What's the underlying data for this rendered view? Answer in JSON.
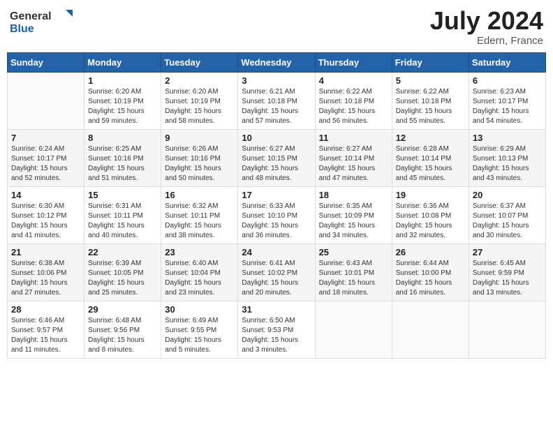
{
  "logo": {
    "line1": "General",
    "line2": "Blue"
  },
  "title": "July 2024",
  "location": "Edern, France",
  "days_header": [
    "Sunday",
    "Monday",
    "Tuesday",
    "Wednesday",
    "Thursday",
    "Friday",
    "Saturday"
  ],
  "weeks": [
    [
      {
        "num": "",
        "info": ""
      },
      {
        "num": "1",
        "info": "Sunrise: 6:20 AM\nSunset: 10:19 PM\nDaylight: 15 hours\nand 59 minutes."
      },
      {
        "num": "2",
        "info": "Sunrise: 6:20 AM\nSunset: 10:19 PM\nDaylight: 15 hours\nand 58 minutes."
      },
      {
        "num": "3",
        "info": "Sunrise: 6:21 AM\nSunset: 10:18 PM\nDaylight: 15 hours\nand 57 minutes."
      },
      {
        "num": "4",
        "info": "Sunrise: 6:22 AM\nSunset: 10:18 PM\nDaylight: 15 hours\nand 56 minutes."
      },
      {
        "num": "5",
        "info": "Sunrise: 6:22 AM\nSunset: 10:18 PM\nDaylight: 15 hours\nand 55 minutes."
      },
      {
        "num": "6",
        "info": "Sunrise: 6:23 AM\nSunset: 10:17 PM\nDaylight: 15 hours\nand 54 minutes."
      }
    ],
    [
      {
        "num": "7",
        "info": "Sunrise: 6:24 AM\nSunset: 10:17 PM\nDaylight: 15 hours\nand 52 minutes."
      },
      {
        "num": "8",
        "info": "Sunrise: 6:25 AM\nSunset: 10:16 PM\nDaylight: 15 hours\nand 51 minutes."
      },
      {
        "num": "9",
        "info": "Sunrise: 6:26 AM\nSunset: 10:16 PM\nDaylight: 15 hours\nand 50 minutes."
      },
      {
        "num": "10",
        "info": "Sunrise: 6:27 AM\nSunset: 10:15 PM\nDaylight: 15 hours\nand 48 minutes."
      },
      {
        "num": "11",
        "info": "Sunrise: 6:27 AM\nSunset: 10:14 PM\nDaylight: 15 hours\nand 47 minutes."
      },
      {
        "num": "12",
        "info": "Sunrise: 6:28 AM\nSunset: 10:14 PM\nDaylight: 15 hours\nand 45 minutes."
      },
      {
        "num": "13",
        "info": "Sunrise: 6:29 AM\nSunset: 10:13 PM\nDaylight: 15 hours\nand 43 minutes."
      }
    ],
    [
      {
        "num": "14",
        "info": "Sunrise: 6:30 AM\nSunset: 10:12 PM\nDaylight: 15 hours\nand 41 minutes."
      },
      {
        "num": "15",
        "info": "Sunrise: 6:31 AM\nSunset: 10:11 PM\nDaylight: 15 hours\nand 40 minutes."
      },
      {
        "num": "16",
        "info": "Sunrise: 6:32 AM\nSunset: 10:11 PM\nDaylight: 15 hours\nand 38 minutes."
      },
      {
        "num": "17",
        "info": "Sunrise: 6:33 AM\nSunset: 10:10 PM\nDaylight: 15 hours\nand 36 minutes."
      },
      {
        "num": "18",
        "info": "Sunrise: 6:35 AM\nSunset: 10:09 PM\nDaylight: 15 hours\nand 34 minutes."
      },
      {
        "num": "19",
        "info": "Sunrise: 6:36 AM\nSunset: 10:08 PM\nDaylight: 15 hours\nand 32 minutes."
      },
      {
        "num": "20",
        "info": "Sunrise: 6:37 AM\nSunset: 10:07 PM\nDaylight: 15 hours\nand 30 minutes."
      }
    ],
    [
      {
        "num": "21",
        "info": "Sunrise: 6:38 AM\nSunset: 10:06 PM\nDaylight: 15 hours\nand 27 minutes."
      },
      {
        "num": "22",
        "info": "Sunrise: 6:39 AM\nSunset: 10:05 PM\nDaylight: 15 hours\nand 25 minutes."
      },
      {
        "num": "23",
        "info": "Sunrise: 6:40 AM\nSunset: 10:04 PM\nDaylight: 15 hours\nand 23 minutes."
      },
      {
        "num": "24",
        "info": "Sunrise: 6:41 AM\nSunset: 10:02 PM\nDaylight: 15 hours\nand 20 minutes."
      },
      {
        "num": "25",
        "info": "Sunrise: 6:43 AM\nSunset: 10:01 PM\nDaylight: 15 hours\nand 18 minutes."
      },
      {
        "num": "26",
        "info": "Sunrise: 6:44 AM\nSunset: 10:00 PM\nDaylight: 15 hours\nand 16 minutes."
      },
      {
        "num": "27",
        "info": "Sunrise: 6:45 AM\nSunset: 9:59 PM\nDaylight: 15 hours\nand 13 minutes."
      }
    ],
    [
      {
        "num": "28",
        "info": "Sunrise: 6:46 AM\nSunset: 9:57 PM\nDaylight: 15 hours\nand 11 minutes."
      },
      {
        "num": "29",
        "info": "Sunrise: 6:48 AM\nSunset: 9:56 PM\nDaylight: 15 hours\nand 8 minutes."
      },
      {
        "num": "30",
        "info": "Sunrise: 6:49 AM\nSunset: 9:55 PM\nDaylight: 15 hours\nand 5 minutes."
      },
      {
        "num": "31",
        "info": "Sunrise: 6:50 AM\nSunset: 9:53 PM\nDaylight: 15 hours\nand 3 minutes."
      },
      {
        "num": "",
        "info": ""
      },
      {
        "num": "",
        "info": ""
      },
      {
        "num": "",
        "info": ""
      }
    ]
  ]
}
